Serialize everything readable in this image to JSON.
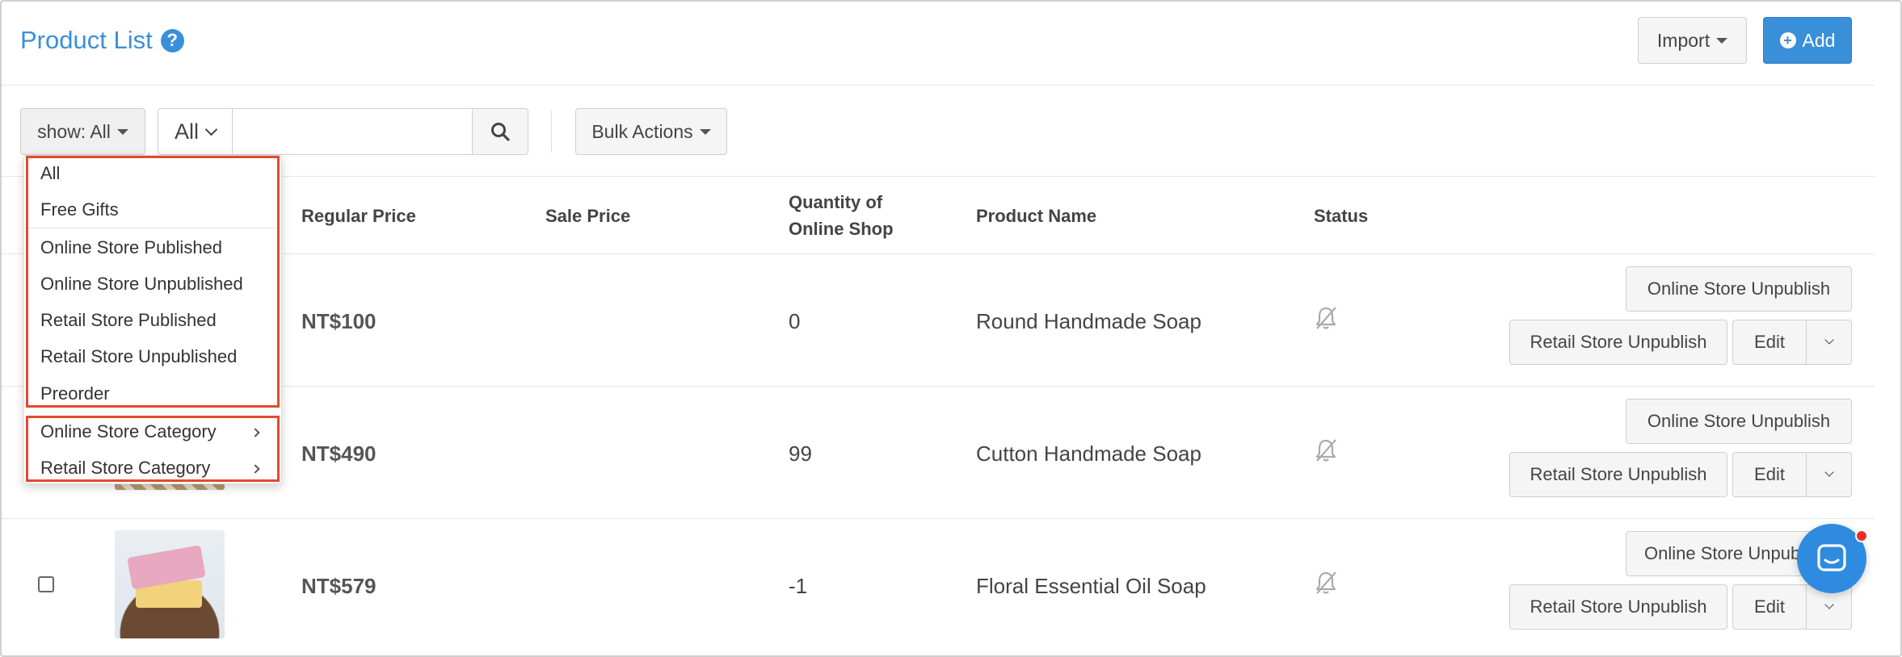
{
  "header": {
    "title": "Product List",
    "help_glyph": "?",
    "import_label": "Import",
    "add_label": "Add"
  },
  "toolbar": {
    "show_label": "show: All",
    "search_scope": "All",
    "search_value": "",
    "bulk_label": "Bulk Actions"
  },
  "table": {
    "headers": {
      "regular_price": "Regular Price",
      "sale_price": "Sale Price",
      "quantity_line1": "Quantity of",
      "quantity_line2": "Online Shop",
      "product_name": "Product Name",
      "status": "Status"
    },
    "rows": [
      {
        "regular_price": "NT$100",
        "sale_price": "",
        "quantity": "0",
        "name": "Round Handmade Soap"
      },
      {
        "regular_price": "NT$490",
        "sale_price": "",
        "quantity": "99",
        "name": "Cutton Handmade Soap"
      },
      {
        "regular_price": "NT$579",
        "sale_price": "",
        "quantity": "-1",
        "name": "Floral Essential Oil Soap"
      }
    ],
    "row_actions": {
      "online_unpublish": "Online Store Unpublish",
      "retail_unpublish": "Retail Store Unpublish",
      "edit": "Edit"
    }
  },
  "dropdown": {
    "items": [
      "All",
      "Free Gifts",
      "Online Store Published",
      "Online Store Unpublished",
      "Retail Store Published",
      "Retail Store Unpublished",
      "Preorder",
      "Online Store Category",
      "Retail Store Category"
    ]
  },
  "colors": {
    "accent": "#3a8fd9",
    "highlight": "#e24a2e",
    "notification": "#e8302a"
  },
  "icons": {
    "help": "question-circle-icon",
    "add": "plus-circle-icon",
    "search": "search-icon",
    "status": "bell-slash-icon",
    "chat": "chat-bubble-icon"
  }
}
